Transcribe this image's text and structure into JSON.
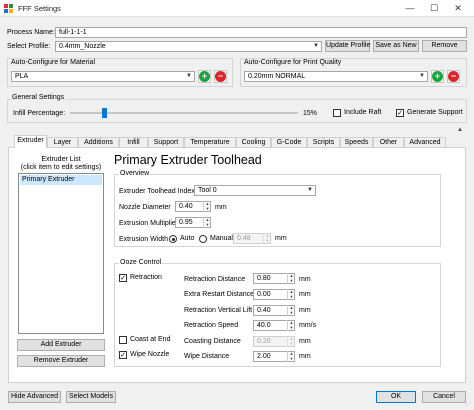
{
  "window": {
    "title": "FFF Settings",
    "minimize": "—",
    "maximize": "☐",
    "close": "✕"
  },
  "process_name": {
    "label": "Process Name:",
    "value": "full-1-1-1"
  },
  "select_profile": {
    "label": "Select Profile:",
    "value": "0.4mm_Nozzle",
    "update": "Update Profile",
    "save_as_new": "Save as New",
    "remove": "Remove"
  },
  "auto_material": {
    "title": "Auto-Configure for Material",
    "value": "PLA"
  },
  "auto_quality": {
    "title": "Auto-Configure for Print Quality",
    "value": "0.20mm NORMAL"
  },
  "general": {
    "title": "General Settings",
    "infill_label": "Infill Percentage:",
    "infill_value": "15%",
    "infill_fraction": 0.15,
    "include_raft": {
      "label": "Include Raft",
      "checked": false
    },
    "generate_support": {
      "label": "Generate Support",
      "checked": true
    }
  },
  "tabs": [
    "Extruder",
    "Layer",
    "Additions",
    "Infill",
    "Support",
    "Temperature",
    "Cooling",
    "G-Code",
    "Scripts",
    "Speeds",
    "Other",
    "Advanced"
  ],
  "extruder_list": {
    "title": "Extruder List",
    "subtitle": "(click item to edit settings)",
    "items": [
      "Primary Extruder"
    ],
    "add": "Add Extruder",
    "remove": "Remove Extruder"
  },
  "toolhead": {
    "heading": "Primary Extruder Toolhead",
    "overview": {
      "title": "Overview",
      "toolhead_index_label": "Extruder Toolhead Index",
      "toolhead_index_value": "Tool 0",
      "nozzle_label": "Nozzle Diameter",
      "nozzle_value": "0.40",
      "nozzle_unit": "mm",
      "mult_label": "Extrusion Multiplier",
      "mult_value": "0.95",
      "width_label": "Extrusion Width",
      "width_auto": "Auto",
      "width_manual": "Manual",
      "width_value": "0.48",
      "width_unit": "mm"
    },
    "ooze": {
      "title": "Ooze Control",
      "retraction_label": "Retraction",
      "retraction_checked": true,
      "coast_label": "Coast at End",
      "coast_checked": false,
      "wipe_label": "Wipe Nozzle",
      "wipe_checked": true,
      "rows": [
        {
          "label": "Retraction Distance",
          "value": "0.80",
          "unit": "mm"
        },
        {
          "label": "Extra Restart Distance",
          "value": "0.00",
          "unit": "mm"
        },
        {
          "label": "Retraction Vertical Lift",
          "value": "0.40",
          "unit": "mm"
        },
        {
          "label": "Retraction Speed",
          "value": "40.0",
          "unit": "mm/s"
        },
        {
          "label": "Coasting Distance",
          "value": "0.20",
          "unit": "mm"
        },
        {
          "label": "Wipe Distance",
          "value": "2.00",
          "unit": "mm"
        }
      ]
    }
  },
  "bottom": {
    "hide_advanced": "Hide Advanced",
    "select_models": "Select Models",
    "ok": "OK",
    "cancel": "Cancel"
  },
  "colors": {
    "accent": "#0078d7",
    "add": "#1ea23a",
    "remove": "#d9262b"
  }
}
